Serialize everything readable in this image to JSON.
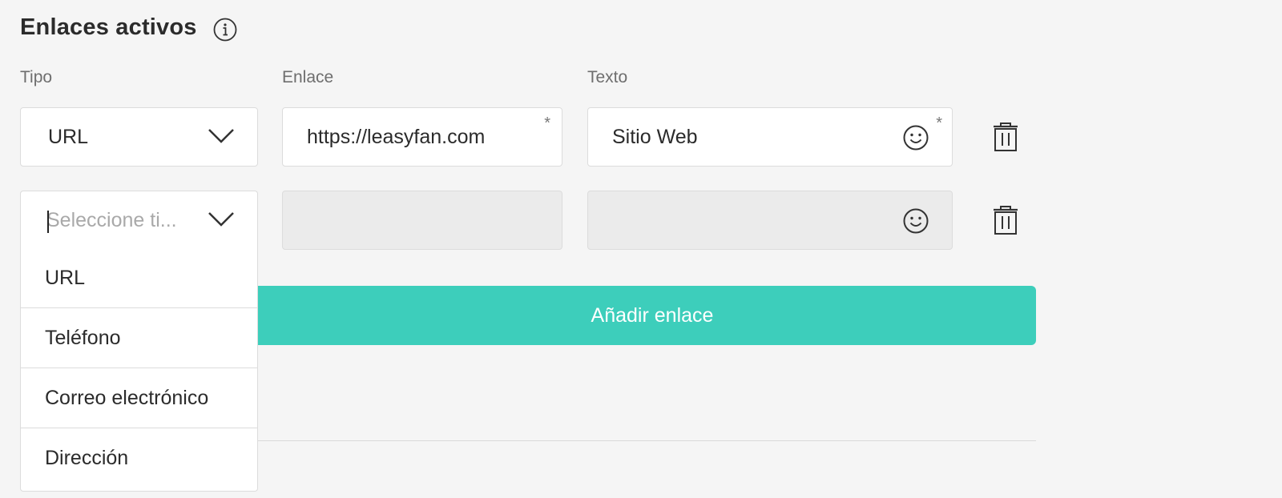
{
  "section": {
    "title": "Enlaces activos",
    "info_icon": "info-circle-icon"
  },
  "columns": {
    "tipo": "Tipo",
    "enlace": "Enlace",
    "texto": "Texto"
  },
  "rows": [
    {
      "tipo_value": "URL",
      "enlace_value": "https://leasyfan.com",
      "texto_value": "Sitio Web",
      "required_mark": "*"
    },
    {
      "tipo_placeholder": "Seleccione ti...",
      "enlace_value": "",
      "texto_value": ""
    }
  ],
  "add_button": {
    "label": "Añadir enlace"
  },
  "dropdown_options": [
    "URL",
    "Teléfono",
    "Correo electrónico",
    "Dirección"
  ],
  "icons": {
    "chevron": "chevron-down-icon",
    "emoji": "smiley-icon",
    "delete": "trash-icon"
  },
  "colors": {
    "accent": "#3dcebb",
    "background": "#f5f5f5",
    "disabled_field": "#ebebeb"
  }
}
